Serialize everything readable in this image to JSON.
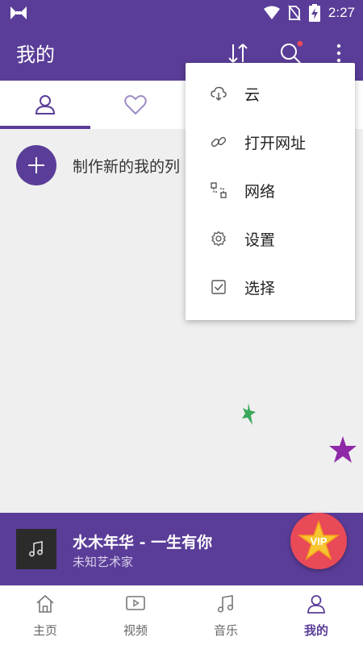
{
  "status_bar": {
    "time": "2:27",
    "icons": [
      "app-logo-icon",
      "wifi-icon",
      "no-sim-icon",
      "battery-charging-icon"
    ]
  },
  "app_bar": {
    "title": "我的",
    "icons": [
      "sort-icon",
      "search-icon",
      "more-vert-icon"
    ]
  },
  "tabs": [
    {
      "icon": "person-icon",
      "active": true
    },
    {
      "icon": "heart-icon",
      "active": false
    }
  ],
  "create_playlist": {
    "label": "制作新的我的列"
  },
  "overflow_menu": {
    "items": [
      {
        "label": "云",
        "icon": "cloud-icon"
      },
      {
        "label": "打开网址",
        "icon": "link-icon"
      },
      {
        "label": "网络",
        "icon": "network-icon"
      },
      {
        "label": "设置",
        "icon": "settings-icon"
      },
      {
        "label": "选择",
        "icon": "checkbox-icon"
      }
    ]
  },
  "now_playing": {
    "title": "水木年华 - 一生有你",
    "artist": "未知艺术家"
  },
  "vip_badge": {
    "label": "VIP"
  },
  "bottom_nav": [
    {
      "label": "主页",
      "icon": "home-icon",
      "active": false
    },
    {
      "label": "视频",
      "icon": "video-icon",
      "active": false
    },
    {
      "label": "音乐",
      "icon": "music-note-icon",
      "active": false
    },
    {
      "label": "我的",
      "icon": "person-icon",
      "active": true
    }
  ],
  "colors": {
    "primary": "#5a3d98",
    "accent_red": "#e84a58",
    "star_green": "#3aa85a",
    "star_purple": "#8e2aa8",
    "vip_star": "#f7c531"
  }
}
